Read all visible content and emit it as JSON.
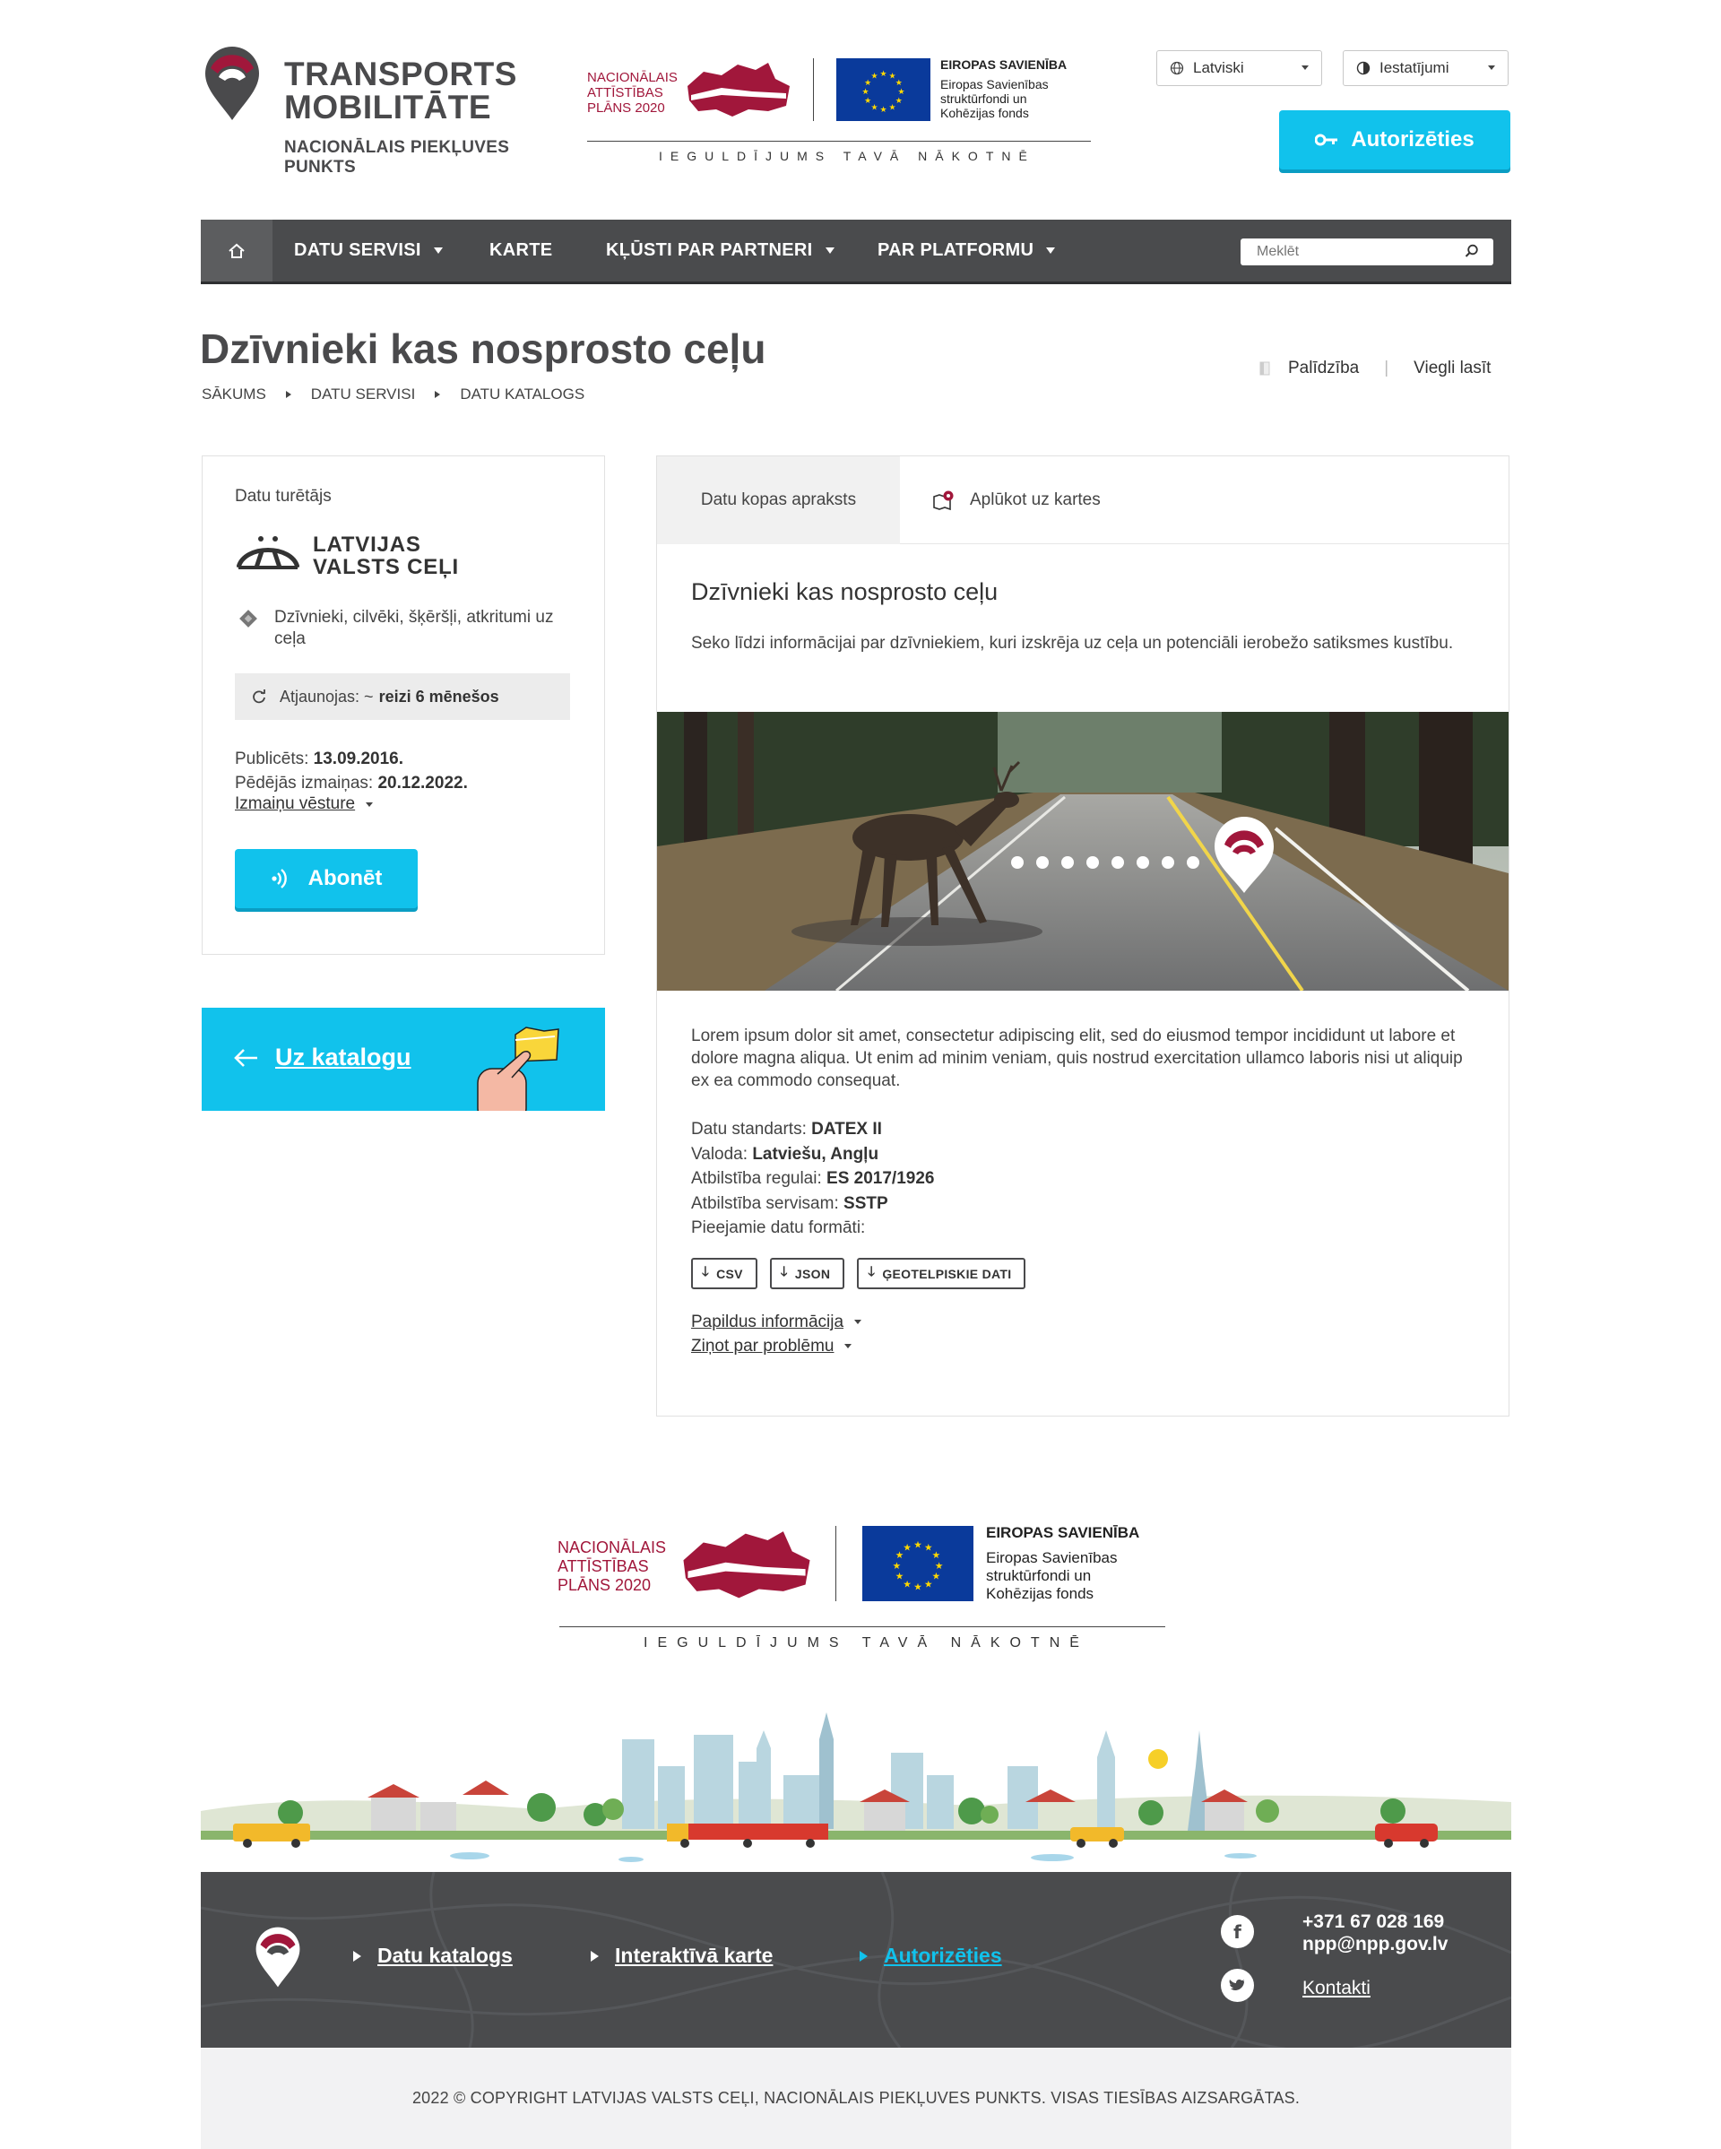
{
  "header": {
    "logo_title_line1": "TRANSPORTS",
    "logo_title_line2": "MOBILITĀTE",
    "logo_subtitle": "NACIONĀLAIS PIEKĻUVES PUNKTS",
    "funding": {
      "nap_line1": "NACIONĀLAIS",
      "nap_line2": "ATTĪSTĪBAS",
      "nap_line3": "PLĀNS 2020",
      "eu_title": "EIROPAS SAVIENĪBA",
      "eu_line1": "Eiropas Savienības",
      "eu_line2": "struktūrfondi un",
      "eu_line3": "Kohēzijas fonds",
      "caption": "IEGULDĪJUMS TAVĀ NĀKOTNĒ"
    },
    "language": "Latviski",
    "settings": "Iestatījumi",
    "login_label": "Autorizēties"
  },
  "nav": {
    "items": [
      {
        "label": "DATU SERVISI"
      },
      {
        "label": "KARTE"
      },
      {
        "label": "KĻŪSTI PAR PARTNERI"
      },
      {
        "label": "PAR PLATFORMU"
      }
    ],
    "search_placeholder": "Meklēt"
  },
  "page": {
    "title": "Dzīvnieki kas nosprosto ceļu",
    "breadcrumb": [
      "SĀKUMS",
      "DATU SERVISI",
      "DATU KATALOGS"
    ],
    "help": "Palīdzība",
    "easy_read": "Viegli lasīt"
  },
  "owner_card": {
    "label": "Datu turētājs",
    "owner_line1": "LATVIJAS",
    "owner_line2": "VALSTS CEĻI",
    "category": "Dzīvnieki, cilvēki, šķēršļi, atkritumi uz ceļa",
    "update_label": "Atjaunojas: ~",
    "update_value": "reizi 6 mēnešos",
    "published_label": "Publicēts:",
    "published_value": "13.09.2016.",
    "modified_label": "Pēdējās izmaiņas:",
    "modified_value": "20.12.2022.",
    "history_link": "Izmaiņu vēsture",
    "subscribe_label": "Abonēt"
  },
  "catalog_button": {
    "label": "Uz katalogu"
  },
  "dataset": {
    "tabs": [
      "Datu kopas apraksts",
      "Aplūkot uz kartes"
    ],
    "title": "Dzīvnieki kas nosprosto ceļu",
    "lead": "Seko līdzi informācijai par dzīvniekiem, kuri izskrēja uz ceļa un potenciāli ierobežo satiksmes kustību.",
    "body": "Lorem ipsum dolor sit amet, consectetur adipiscing elit, sed do eiusmod tempor incididunt ut labore et dolore magna aliqua. Ut enim ad minim veniam, quis nostrud exercitation ullamco laboris nisi ut aliquip ex ea commodo consequat.",
    "meta": [
      {
        "label": "Datu standarts:",
        "value": "DATEX II"
      },
      {
        "label": "Valoda:",
        "value": "Latviešu, Angļu"
      },
      {
        "label": "Atbilstība regulai:",
        "value": "ES 2017/1926"
      },
      {
        "label": "Atbilstība servisam:",
        "value": "SSTP"
      },
      {
        "label": "Pieejamie datu formāti:",
        "value": ""
      }
    ],
    "formats": [
      "CSV",
      "JSON",
      "ĢEOTELPISKIE DATI"
    ],
    "more_info": "Papildus informācija",
    "report_problem": "Ziņot par problēmu"
  },
  "footer": {
    "links": [
      "Datu katalogs",
      "Interaktīvā karte",
      "Autorizēties"
    ],
    "phone": "+371 67 028 169",
    "email": "npp@npp.gov.lv",
    "contacts": "Kontakti",
    "copyright": "2022 © COPYRIGHT LATVIJAS VALSTS CEĻI, NACIONĀLAIS PIEKĻUVES PUNKTS. VISAS TIESĪBAS AIZSARGĀTAS."
  },
  "colors": {
    "accent": "#11c2ec",
    "brand_red": "#a1173b",
    "nav_dark": "#4a4b4d",
    "eu_blue": "#0a3a9b"
  }
}
